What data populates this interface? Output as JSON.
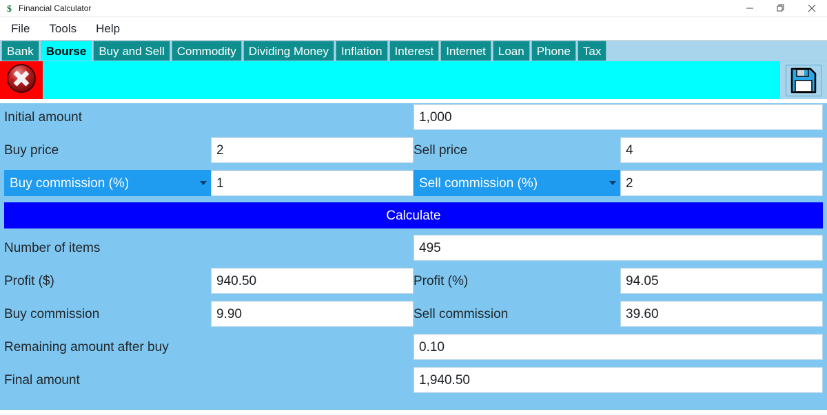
{
  "window": {
    "title": "Financial Calculator",
    "icon": "dollar-sign-icon",
    "minimize_label": "—",
    "restore_label": "❐",
    "close_label": "✕"
  },
  "menu": {
    "items": [
      {
        "label": "File"
      },
      {
        "label": "Tools"
      },
      {
        "label": "Help"
      }
    ]
  },
  "tabs": {
    "active": "Bourse",
    "items": [
      {
        "label": "Bank"
      },
      {
        "label": "Bourse"
      },
      {
        "label": "Buy and Sell"
      },
      {
        "label": "Commodity"
      },
      {
        "label": "Dividing Money"
      },
      {
        "label": "Inflation"
      },
      {
        "label": "Interest"
      },
      {
        "label": "Internet"
      },
      {
        "label": "Loan"
      },
      {
        "label": "Phone"
      },
      {
        "label": "Tax"
      }
    ]
  },
  "toolbar": {
    "close_icon": "close-circle-icon",
    "save_icon": "floppy-disk-save-icon"
  },
  "form": {
    "initial_amount": {
      "label": "Initial amount",
      "value": "1,000"
    },
    "buy_price": {
      "label": "Buy price",
      "value": "2"
    },
    "sell_price": {
      "label": "Sell price",
      "value": "4"
    },
    "buy_commission_pct": {
      "label": "Buy commission (%)",
      "value": "1"
    },
    "sell_commission_pct": {
      "label": "Sell commission (%)",
      "value": "2"
    },
    "calculate_label": "Calculate"
  },
  "results": {
    "number_of_items": {
      "label": "Number of items",
      "value": "495"
    },
    "profit_dollar": {
      "label": "Profit ($)",
      "value": "940.50"
    },
    "profit_percent": {
      "label": "Profit (%)",
      "value": "94.05"
    },
    "buy_commission": {
      "label": "Buy commission",
      "value": "9.90"
    },
    "sell_commission": {
      "label": "Sell commission",
      "value": "39.60"
    },
    "remaining_after_buy": {
      "label": "Remaining amount after buy",
      "value": "0.10"
    },
    "final_amount": {
      "label": "Final amount",
      "value": "1,940.50"
    }
  },
  "colors": {
    "form_background": "#7fc7f0",
    "toolbar": "#00ffff",
    "tab_inactive": "#0e8e8e",
    "tab_active": "#00ffff",
    "combo": "#1f9bf0",
    "calculate": "#0000ff",
    "close_button": "#ff0000"
  }
}
